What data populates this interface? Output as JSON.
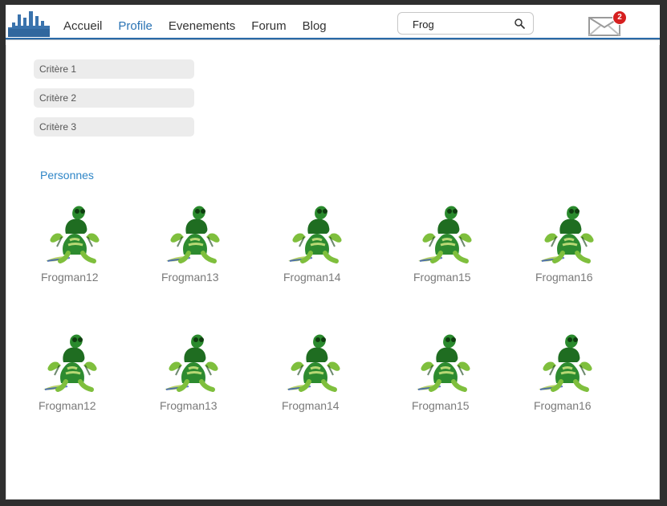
{
  "nav": {
    "items": [
      {
        "label": "Accueil",
        "active": false
      },
      {
        "label": "Profile",
        "active": true
      },
      {
        "label": "Evenements",
        "active": false
      },
      {
        "label": "Forum",
        "active": false
      },
      {
        "label": "Blog",
        "active": false
      }
    ],
    "accent": "#2a73b4"
  },
  "search": {
    "value": "Frog",
    "placeholder": ""
  },
  "mail": {
    "badge_count": "2"
  },
  "criteria": [
    "Critère 1",
    "Critère 2",
    "Critère 3"
  ],
  "section_title": "Personnes",
  "people_row1": [
    "Frogman12",
    "Frogman13",
    "Frogman14",
    "Frogman15",
    "Frogman16"
  ],
  "people_row2": [
    "Frogman12",
    "Frogman13",
    "Frogman14",
    "Frogman15",
    "Frogman16"
  ],
  "icons": {
    "logo": "city-skyline-logo",
    "search": "search-icon",
    "mail": "envelope-icon",
    "avatar": "frog-avatar-image"
  }
}
